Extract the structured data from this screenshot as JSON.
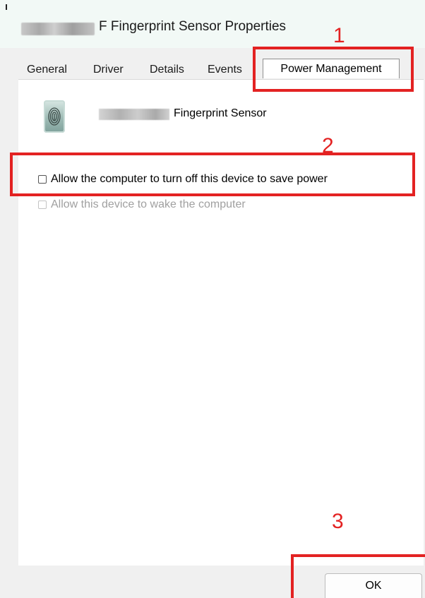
{
  "window": {
    "title": "F Fingerprint Sensor Properties"
  },
  "tabs": [
    {
      "label": "General"
    },
    {
      "label": "Driver"
    },
    {
      "label": "Details"
    },
    {
      "label": "Events"
    },
    {
      "label": "Power Management",
      "active": true
    }
  ],
  "device": {
    "name": "Fingerprint Sensor",
    "icon": "fingerprint-icon"
  },
  "options": [
    {
      "label": "Allow the computer to turn off this device to save power",
      "checked": false,
      "enabled": true
    },
    {
      "label": "Allow this device to wake the computer",
      "checked": false,
      "enabled": false
    }
  ],
  "buttons": {
    "ok_label": "OK"
  },
  "annotations": {
    "step1": "1",
    "step2": "2",
    "step3": "3",
    "color": "#e32222"
  }
}
